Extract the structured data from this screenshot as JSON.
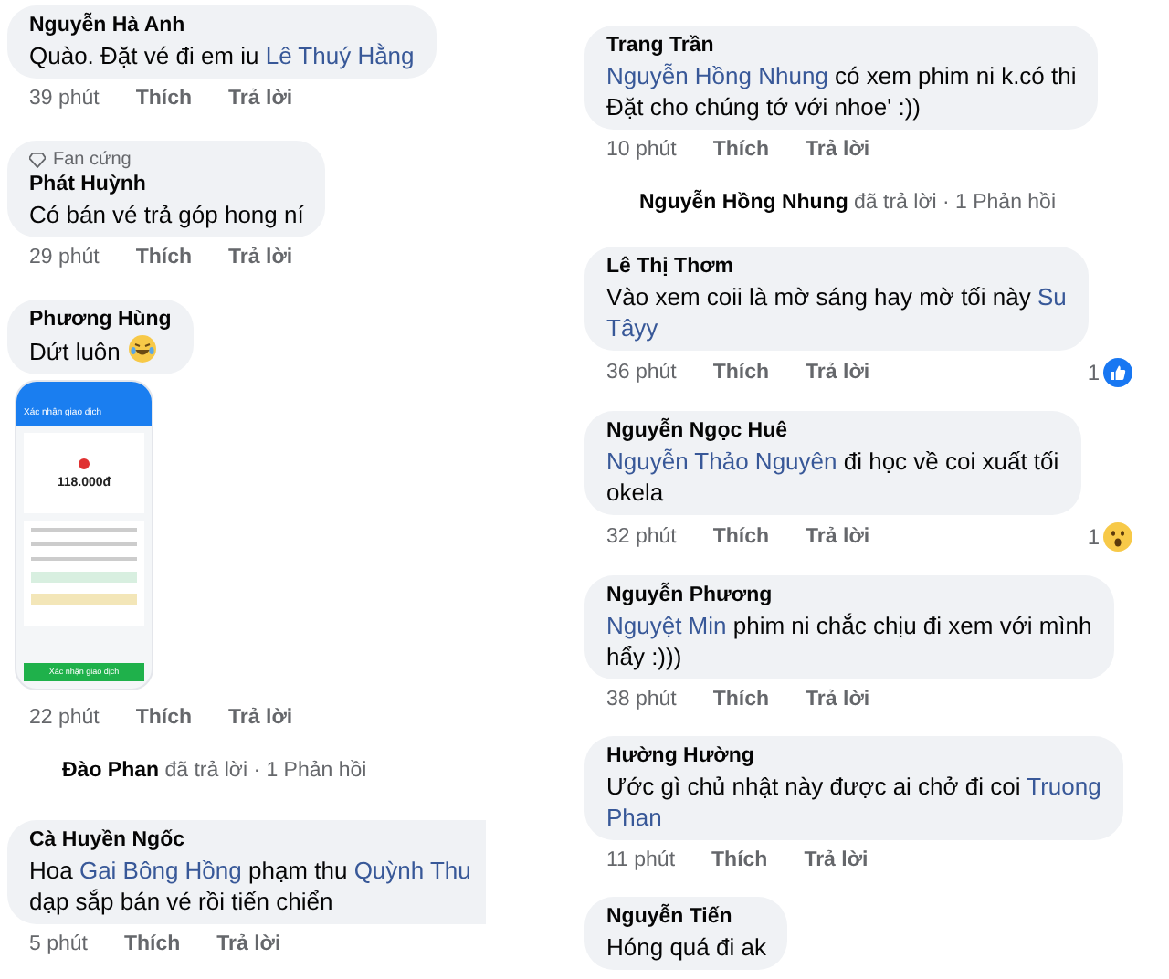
{
  "columns": [
    {
      "comments": [
        {
          "name": "Nguyễn Hà Anh",
          "segments": [
            {
              "kind": "text",
              "text": "Quào. Đặt vé đi em iu "
            },
            {
              "kind": "mention",
              "text": "Lê Thuý Hằng"
            }
          ],
          "time": "39 phút",
          "like": "Thích",
          "reply": "Trả lời"
        },
        {
          "badge": "Fan cứng",
          "name": "Phát Huỳnh",
          "segments": [
            {
              "kind": "text",
              "text": "Có bán vé trả góp hong ní"
            }
          ],
          "time": "29 phút",
          "like": "Thích",
          "reply": "Trả lời"
        },
        {
          "name": "Phương Hùng",
          "segments": [
            {
              "kind": "text",
              "text": "Dứt luôn "
            },
            {
              "kind": "laugh"
            }
          ],
          "attachment": {
            "header": "Xác nhận giao dịch",
            "amount": "118.000đ",
            "button": "Xác nhận giao dịch"
          },
          "time": "22 phút",
          "like": "Thích",
          "reply": "Trả lời",
          "replies": "**Đào Phan** đã trả lời · 1 Phản hồi"
        },
        {
          "name": "Cà Huyền Ngốc",
          "segments": [
            {
              "kind": "text",
              "text": "Hoa "
            },
            {
              "kind": "mention",
              "text": "Gai Bông Hồng"
            },
            {
              "kind": "text",
              "text": " phạm thu "
            },
            {
              "kind": "mention",
              "text": "Quỳnh Thu"
            },
            {
              "kind": "break"
            },
            {
              "kind": "text",
              "text": "dạp sắp bán vé rồi tiến chiển"
            }
          ],
          "cut": true,
          "time": "5 phút",
          "like": "Thích",
          "reply": "Trả lời"
        }
      ]
    },
    {
      "comments": [
        {
          "name": "Trang Trần",
          "segments": [
            {
              "kind": "mention",
              "text": "Nguyễn Hồng Nhung"
            },
            {
              "kind": "text",
              "text": "  có xem phim ni k.có thi"
            },
            {
              "kind": "break"
            },
            {
              "kind": "text",
              "text": "Đặt cho chúng tớ  với nhoe' :))"
            }
          ],
          "time": "10 phút",
          "like": "Thích",
          "reply": "Trả lời",
          "replies": "**Nguyễn Hồng Nhung** đã trả lời · 1 Phản hồi"
        },
        {
          "name": "Lê Thị Thơm",
          "segments": [
            {
              "kind": "text",
              "text": "Vào xem coii là mờ sáng hay mờ tối này "
            },
            {
              "kind": "mention",
              "text": "Su"
            },
            {
              "kind": "break"
            },
            {
              "kind": "mention",
              "text": "Tâyy"
            }
          ],
          "time": "36 phút",
          "like": "Thích",
          "reply": "Trả lời",
          "reaction": {
            "kind": "like",
            "count": "1"
          }
        },
        {
          "name": "Nguyễn Ngọc Huê",
          "segments": [
            {
              "kind": "mention",
              "text": "Nguyễn Thảo Nguyên"
            },
            {
              "kind": "text",
              "text": "  đi học về coi xuất tối"
            },
            {
              "kind": "break"
            },
            {
              "kind": "text",
              "text": "okela"
            }
          ],
          "time": "32 phút",
          "like": "Thích",
          "reply": "Trả lời",
          "reaction": {
            "kind": "wow",
            "count": "1"
          }
        },
        {
          "name": "Nguyễn Phương",
          "segments": [
            {
              "kind": "mention",
              "text": "Nguyệt Min"
            },
            {
              "kind": "text",
              "text": " phim ni chắc chịu đi xem với mình"
            },
            {
              "kind": "break"
            },
            {
              "kind": "text",
              "text": "hẩy :)))"
            }
          ],
          "time": "38 phút",
          "like": "Thích",
          "reply": "Trả lời"
        },
        {
          "name": "Hường Hường",
          "segments": [
            {
              "kind": "text",
              "text": "Ước gì chủ nhật này được ai chở đi coi "
            },
            {
              "kind": "mention",
              "text": "Truong"
            },
            {
              "kind": "break"
            },
            {
              "kind": "mention",
              "text": "Phan"
            }
          ],
          "time": "11 phút",
          "like": "Thích",
          "reply": "Trả lời"
        },
        {
          "name": "Nguyễn Tiến",
          "segments": [
            {
              "kind": "text",
              "text": "Hóng quá đi ak"
            }
          ]
        }
      ]
    }
  ]
}
